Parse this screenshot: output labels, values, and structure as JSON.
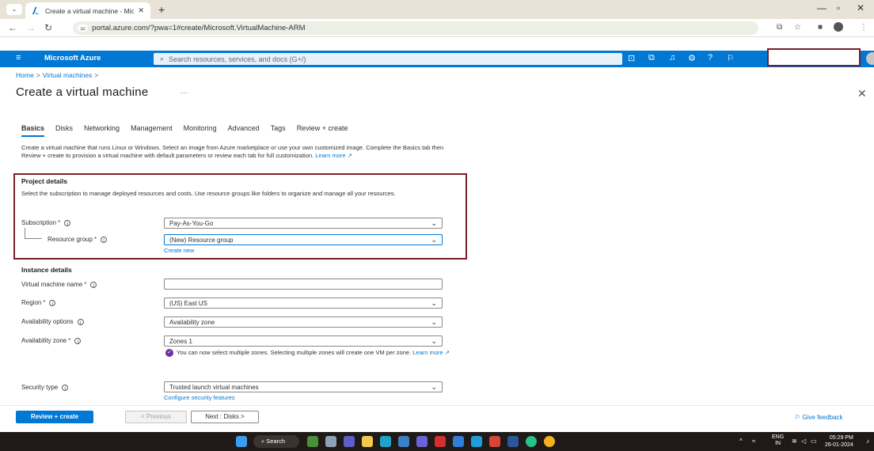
{
  "browser": {
    "tab_title": "Create a virtual machine - Micr",
    "url": "portal.azure.com/?pwa=1#create/Microsoft.VirtualMachine-ARM"
  },
  "azure": {
    "brand": "Microsoft Azure",
    "search_placeholder": "Search resources, services, and docs (G+/)"
  },
  "breadcrumb": {
    "home": "Home",
    "section": "Virtual machines"
  },
  "page": {
    "title": "Create a virtual machine",
    "ellipsis": "···"
  },
  "tabs": [
    "Basics",
    "Disks",
    "Networking",
    "Management",
    "Monitoring",
    "Advanced",
    "Tags",
    "Review + create"
  ],
  "intro": {
    "text": "Create a virtual machine that runs Linux or Windows. Select an image from Azure marketplace or use your own customized image. Complete the Basics tab then Review + create to provision a virtual machine with default parameters or review each tab for full customization.",
    "learn_more": "Learn more"
  },
  "project": {
    "title": "Project details",
    "desc": "Select the subscription to manage deployed resources and costs. Use resource groups like folders to organize and manage all your resources.",
    "subscription_label": "Subscription",
    "subscription_value": "Pay-As-You-Go",
    "resource_group_label": "Resource group",
    "resource_group_value": "(New) Resource group",
    "create_new": "Create new"
  },
  "instance": {
    "title": "Instance details",
    "vm_name_label": "Virtual machine name",
    "vm_name_value": "",
    "region_label": "Region",
    "region_value": "(US) East US",
    "availability_options_label": "Availability options",
    "availability_options_value": "Availability zone",
    "availability_zone_label": "Availability zone",
    "availability_zone_value": "Zones 1",
    "zone_note": "You can now select multiple zones. Selecting multiple zones will create one VM per zone.",
    "zone_note_link": "Learn more",
    "security_type_label": "Security type",
    "security_type_value": "Trusted launch virtual machines",
    "configure_security": "Configure security features"
  },
  "footer": {
    "review_create": "Review + create",
    "previous": "< Previous",
    "next": "Next : Disks >",
    "feedback": "Give feedback"
  },
  "taskbar": {
    "search": "Search",
    "lang_top": "ENG",
    "lang_bottom": "IN",
    "time": "05:29 PM",
    "date": "26-01-2024"
  }
}
